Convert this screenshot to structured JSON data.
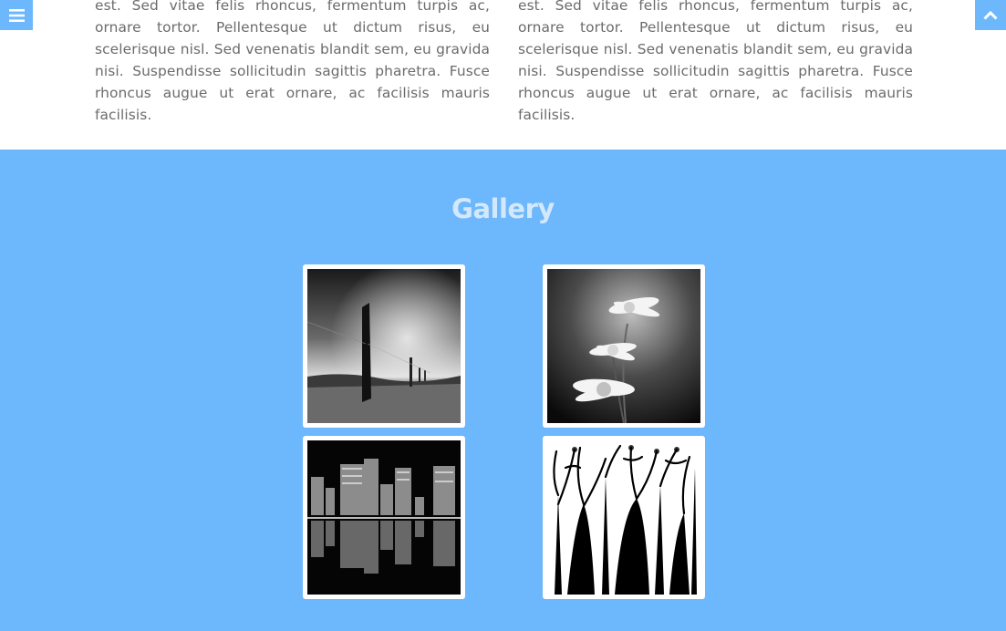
{
  "columns": {
    "left": "est. Sed vitae felis rhoncus, fermentum turpis ac, ornare tortor. Pellentesque ut dictum risus, eu scelerisque nisl. Sed venenatis blandit sem, eu gravida nisi. Suspendisse sollicitudin sagittis pharetra. Fusce rhoncus augue ut erat ornare, ac facilisis mauris facilisis.",
    "right": "est. Sed vitae felis rhoncus, fermentum turpis ac, ornare tortor. Pellentesque ut dictum risus, eu scelerisque nisl. Sed venenatis blandit sem, eu gravida nisi. Suspendisse sollicitudin sagittis pharetra. Fusce rhoncus augue ut erat ornare, ac facilisis mauris facilisis."
  },
  "gallery": {
    "title": "Gallery",
    "images": [
      {
        "icon": "fence-landscape-photo"
      },
      {
        "icon": "daisy-flowers-photo"
      },
      {
        "icon": "city-skyline-reflection-photo"
      },
      {
        "icon": "tree-silhouette-illustration"
      }
    ]
  },
  "colors": {
    "accent": "#6db7fd",
    "title": "#d4e8fc",
    "body_text": "#6b6b6b"
  }
}
